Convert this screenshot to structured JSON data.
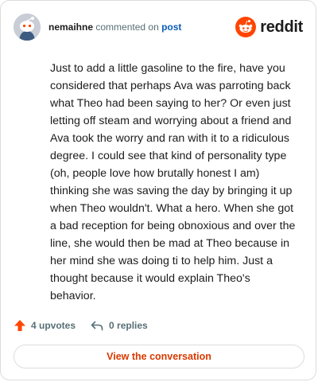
{
  "comment": {
    "author": "nemaihne",
    "action_text": "commented on",
    "post_link": "post",
    "body": "Just to add a little gasoline to the fire, have you considered that perhaps Ava was parroting back what Theo had been saying to her? Or even just letting off steam and worrying about a friend and Ava took the worry and ran with it to a ridiculous degree. I could see that kind of personality type (oh, people love how brutally honest I am) thinking she was saving the day by bringing it up when Theo wouldn't. What a hero. When she got a bad reception for being obnoxious and over the line, she would then be mad at Theo because in her mind she was doing ti to help him. Just a thought because it would explain Theo's behavior."
  },
  "brand": {
    "name": "reddit",
    "color": "#ff4500"
  },
  "actions": {
    "upvotes_label": "4 upvotes",
    "replies_label": "0 replies"
  },
  "cta": {
    "label": "View the conversation"
  },
  "colors": {
    "accent": "#d93900",
    "upvote": "#ff4500",
    "link": "#0b5eb8",
    "muted": "#576f76"
  }
}
